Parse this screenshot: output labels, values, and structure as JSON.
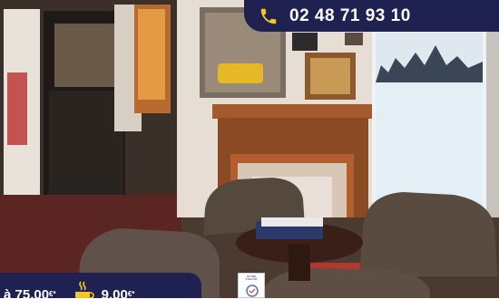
{
  "phone": {
    "number": "02 48 71 93 10"
  },
  "prices": {
    "room_price": "à 75,00",
    "room_currency": "€*",
    "breakfast_price": "9,00",
    "breakfast_currency": "€*"
  },
  "badge": {
    "line1": "NOTRE",
    "line2": "TROUVÉ"
  },
  "colors": {
    "banner_bg": "#1f2150",
    "accent_yellow": "#f3c623",
    "text": "#ffffff"
  },
  "icons": {
    "phone": "phone-icon",
    "breakfast": "coffee-cup-icon"
  }
}
